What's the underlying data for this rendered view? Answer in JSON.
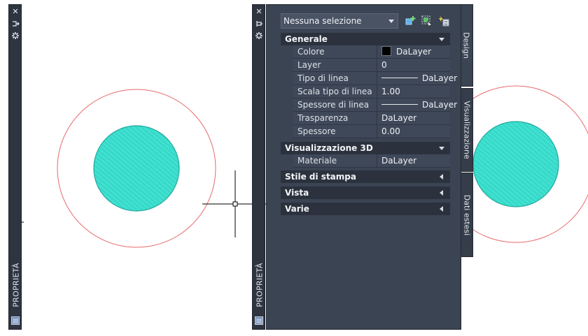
{
  "left_palette": {
    "title": "PROPRIETÀ",
    "close_icon": "close-icon",
    "autohide_icon": "autohide-icon",
    "settings_icon": "settings-icon",
    "bottom_icon": "properties-icon"
  },
  "palette": {
    "title": "PROPRIETÀ",
    "selection": "Nessuna selezione",
    "toolbar_icons": [
      "toggle-pickadd-icon",
      "select-objects-icon",
      "quick-select-icon"
    ],
    "sections": [
      {
        "label": "Generale",
        "expanded": true
      },
      {
        "label": "Visualizzazione 3D",
        "expanded": true
      },
      {
        "label": "Stile di stampa",
        "expanded": false
      },
      {
        "label": "Vista",
        "expanded": false
      },
      {
        "label": "Varie",
        "expanded": false
      }
    ],
    "general_props": [
      {
        "name": "Colore",
        "value": "DaLayer"
      },
      {
        "name": "Layer",
        "value": "0"
      },
      {
        "name": "Tipo di linea",
        "value": "DaLayer"
      },
      {
        "name": "Scala tipo di linea",
        "value": "1.00"
      },
      {
        "name": "Spessore di linea",
        "value": "DaLayer"
      },
      {
        "name": "Trasparenza",
        "value": "DaLayer"
      },
      {
        "name": "Spessore",
        "value": "0.00"
      }
    ],
    "view3d_props": [
      {
        "name": "Materiale",
        "value": "DaLayer"
      }
    ],
    "tabs": [
      "Design",
      "Visualizzazione",
      "Dati estesi"
    ]
  },
  "colors": {
    "circle_outline": "#e86a6a",
    "hatch_fill": "#3fe0d0",
    "hatch_edge": "#1fa89c",
    "palette_bg": "#3b4453"
  }
}
